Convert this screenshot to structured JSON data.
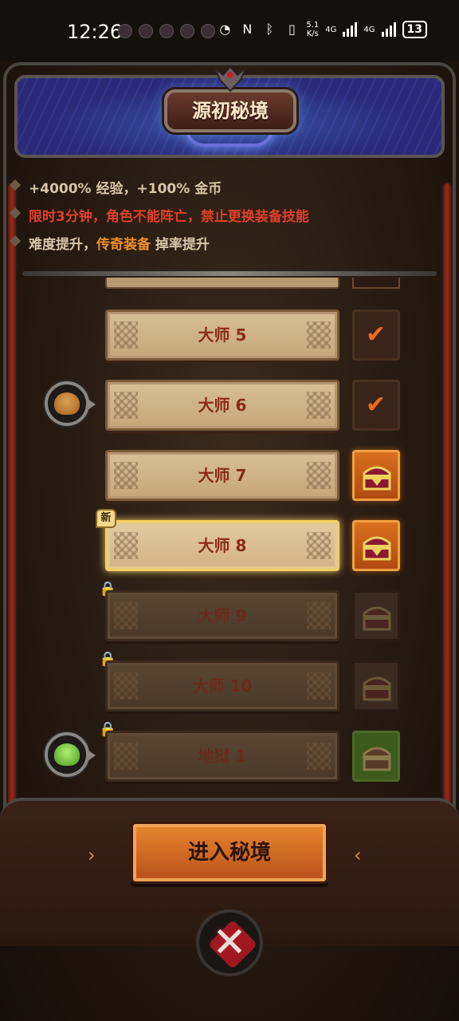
{
  "status_bar": {
    "time": "12:26",
    "speed_top": "5.1",
    "speed_unit": "K/s",
    "net1": "4G",
    "net2": "4G",
    "battery": "13"
  },
  "header": {
    "title": "源初秘境"
  },
  "info": {
    "line1": "+4000% 经验，+100% 金币",
    "line2": "限时3分钟，角色不能阵亡，禁止更换装备技能",
    "line3_prefix": "难度提升，",
    "line3_highlight": "传奇装备",
    "line3_suffix": " 掉率提升"
  },
  "levels": [
    {
      "label": "大师 5",
      "state": "unlocked",
      "chest": "claimed"
    },
    {
      "label": "大师 6",
      "state": "unlocked",
      "chest": "claimed",
      "reward": "hat-icon"
    },
    {
      "label": "大师 7",
      "state": "unlocked",
      "chest": "available"
    },
    {
      "label": "大师 8",
      "state": "selected",
      "chest": "available",
      "badge": "新"
    },
    {
      "label": "大师 9",
      "state": "locked",
      "chest": "locked"
    },
    {
      "label": "大师 10",
      "state": "locked",
      "chest": "locked"
    },
    {
      "label": "地狱 1",
      "state": "locked",
      "chest": "locked-green",
      "reward": "armor-icon"
    }
  ],
  "enter_button": {
    "label": "进入秘境"
  },
  "colors": {
    "accent_orange": "#e8862e",
    "warning_red": "#e0402a",
    "highlight_orange": "#f0902a",
    "header_blue": "#2a2a78"
  }
}
